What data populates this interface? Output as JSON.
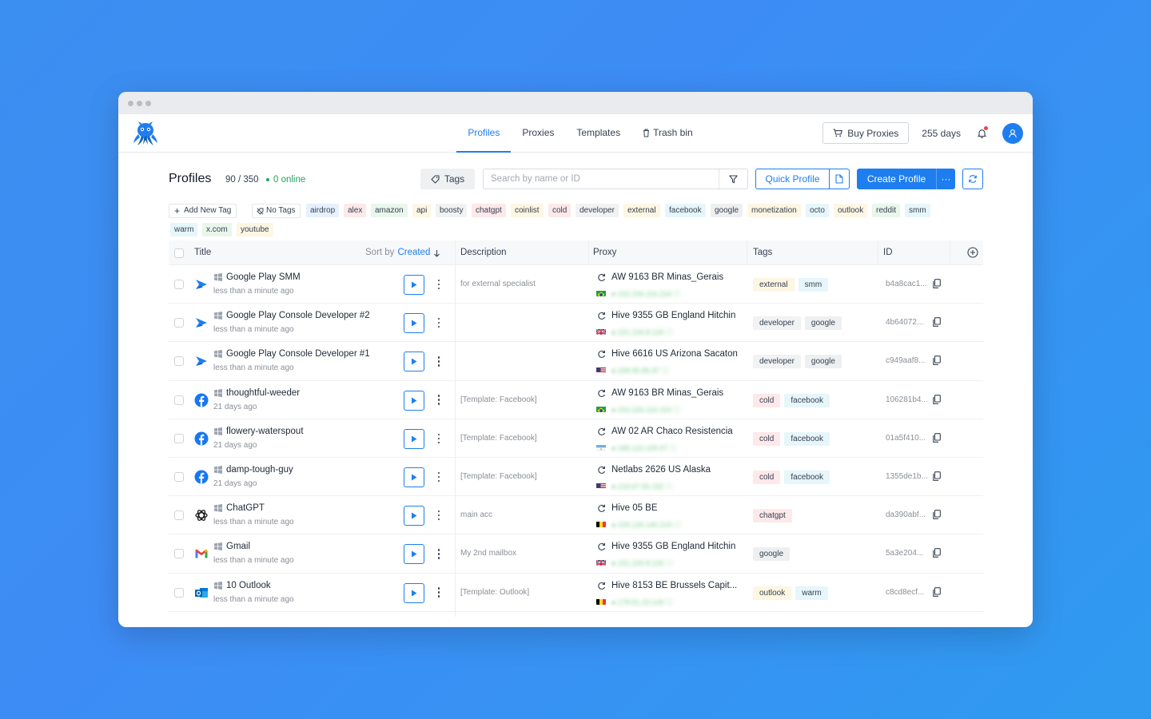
{
  "nav": {
    "tabs": [
      {
        "label": "Profiles",
        "active": true
      },
      {
        "label": "Proxies",
        "active": false
      },
      {
        "label": "Templates",
        "active": false
      },
      {
        "label": "Trash bin",
        "active": false
      }
    ],
    "buy_proxies": "Buy Proxies",
    "days": "255 days"
  },
  "toolbar": {
    "title": "Profiles",
    "count": "90 / 350",
    "online": "0 online",
    "tags_label": "Tags",
    "search_placeholder": "Search by name or ID",
    "quick_profile": "Quick Profile",
    "create_profile": "Create Profile",
    "create_more": "···"
  },
  "tagbar": {
    "add_new_tag": "Add New Tag",
    "no_tags": "No Tags",
    "tags": [
      {
        "label": "airdrop",
        "color": "#e6f1fd"
      },
      {
        "label": "alex",
        "color": "#fde8ea"
      },
      {
        "label": "amazon",
        "color": "#e9f6ec"
      },
      {
        "label": "api",
        "color": "#fdf6e3"
      },
      {
        "label": "boosty",
        "color": "#f1f2f4"
      },
      {
        "label": "chatgpt",
        "color": "#fde8ea"
      },
      {
        "label": "coinlist",
        "color": "#fdf6e3"
      },
      {
        "label": "cold",
        "color": "#fde8ea"
      },
      {
        "label": "developer",
        "color": "#f1f2f4"
      },
      {
        "label": "external",
        "color": "#fdf6e3"
      },
      {
        "label": "facebook",
        "color": "#e6f6fb"
      },
      {
        "label": "google",
        "color": "#eeeff1"
      },
      {
        "label": "monetization",
        "color": "#fdf6e3"
      },
      {
        "label": "octo",
        "color": "#e6f6fb"
      },
      {
        "label": "outlook",
        "color": "#fdf6e3"
      },
      {
        "label": "reddit",
        "color": "#e9f6ec"
      },
      {
        "label": "smm",
        "color": "#e6f6fb"
      },
      {
        "label": "warm",
        "color": "#e6f6fb"
      },
      {
        "label": "x.com",
        "color": "#e9f6ec"
      },
      {
        "label": "youtube",
        "color": "#fdf6e3"
      }
    ]
  },
  "table": {
    "headers": {
      "title": "Title",
      "sort_by": "Sort by",
      "sort_value": "Created",
      "description": "Description",
      "proxy": "Proxy",
      "tags": "Tags",
      "id": "ID"
    },
    "rows": [
      {
        "icon": "google-play-console-icon",
        "name": "Google Play SMM",
        "time": "less than a minute ago",
        "desc": "for external specialist",
        "proxy": "AW 9163 BR Minas_Gerais",
        "flag": "br",
        "ip": "● 152.234.116.224 ⓘ",
        "tags": [
          {
            "label": "external",
            "color": "#fdf6e3"
          },
          {
            "label": "smm",
            "color": "#e6f6fb"
          }
        ],
        "id": "b4a8cac1..."
      },
      {
        "icon": "google-play-console-icon",
        "name": "Google Play Console Developer #2",
        "time": "less than a minute ago",
        "desc": "",
        "proxy": "Hive 9355 GB England Hitchin",
        "flag": "gb",
        "ip": "● 151.226.8.126 ⓘ",
        "tags": [
          {
            "label": "developer",
            "color": "#f1f2f4"
          },
          {
            "label": "google",
            "color": "#eeeff1"
          }
        ],
        "id": "4b64072..."
      },
      {
        "icon": "google-play-console-icon",
        "name": "Google Play Console Developer #1",
        "time": "less than a minute ago",
        "desc": "",
        "proxy": "Hive 6616 US Arizona Sacaton",
        "flag": "us",
        "ip": "● 208.95.85.87 ⓘ",
        "tags": [
          {
            "label": "developer",
            "color": "#f1f2f4"
          },
          {
            "label": "google",
            "color": "#eeeff1"
          }
        ],
        "id": "c949aaf8..."
      },
      {
        "icon": "facebook-icon",
        "name": "thoughtful-weeder",
        "time": "21 days ago",
        "desc": "[Template: Facebook]",
        "proxy": "AW 9163 BR Minas_Gerais",
        "flag": "br",
        "ip": "● 152.234.116.224 ⓘ",
        "tags": [
          {
            "label": "cold",
            "color": "#fde8ea"
          },
          {
            "label": "facebook",
            "color": "#e6f6fb"
          }
        ],
        "id": "106281b4..."
      },
      {
        "icon": "facebook-icon",
        "name": "flowery-waterspout",
        "time": "21 days ago",
        "desc": "[Template: Facebook]",
        "proxy": "AW 02 AR Chaco Resistencia",
        "flag": "ar",
        "ip": "● 186.122.105.57 ⓘ",
        "tags": [
          {
            "label": "cold",
            "color": "#fde8ea"
          },
          {
            "label": "facebook",
            "color": "#e6f6fb"
          }
        ],
        "id": "01a5f410..."
      },
      {
        "icon": "facebook-icon",
        "name": "damp-tough-guy",
        "time": "21 days ago",
        "desc": "[Template: Facebook]",
        "proxy": "Netlabs 2626 US Alaska",
        "flag": "us",
        "ip": "● 216.67.56.152 ⓘ",
        "tags": [
          {
            "label": "cold",
            "color": "#fde8ea"
          },
          {
            "label": "facebook",
            "color": "#e6f6fb"
          }
        ],
        "id": "1355de1b..."
      },
      {
        "icon": "chatgpt-icon",
        "name": "ChatGPT",
        "time": "less than a minute ago",
        "desc": "main acc",
        "proxy": "Hive 05 BE",
        "flag": "be",
        "ip": "● 109.130.140.219 ⓘ",
        "tags": [
          {
            "label": "chatgpt",
            "color": "#fde8ea"
          }
        ],
        "id": "da390abf..."
      },
      {
        "icon": "gmail-icon",
        "name": "Gmail",
        "time": "less than a minute ago",
        "desc": "My 2nd mailbox",
        "proxy": "Hive 9355 GB England Hitchin",
        "flag": "gb",
        "ip": "● 151.226.8.126 ⓘ",
        "tags": [
          {
            "label": "google",
            "color": "#eeeff1"
          }
        ],
        "id": "5a3e204..."
      },
      {
        "icon": "outlook-icon",
        "name": "10 Outlook",
        "time": "less than a minute ago",
        "desc": "[Template: Outlook]",
        "proxy": "Hive 8153 BE Brussels Capit...",
        "flag": "be",
        "ip": "● 178.51.23.149 ⓘ",
        "tags": [
          {
            "label": "outlook",
            "color": "#fdf6e3"
          },
          {
            "label": "warm",
            "color": "#e6f6fb"
          }
        ],
        "id": "c8cd8ecf..."
      }
    ]
  }
}
